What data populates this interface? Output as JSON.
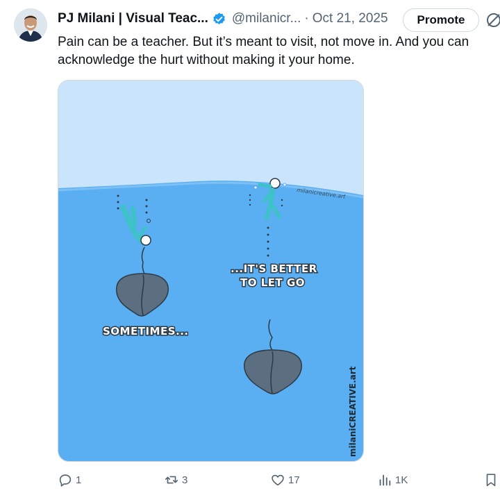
{
  "author": {
    "display_name": "PJ Milani | Visual Teac...",
    "handle": "@milanicr...",
    "separator": "·",
    "date": "Oct 21, 2025"
  },
  "header": {
    "promote_label": "Promote"
  },
  "tweet": {
    "text": "Pain can be a teacher. But it’s meant to visit, not move in. And you can acknowledge the hurt without making it your home."
  },
  "comic": {
    "caption_left": "SOMETIMES...",
    "caption_right_line1": "...IT'S BETTER",
    "caption_right_line2": "TO LET GO",
    "watermark_small": "milanicreative.art",
    "watermark_side": "milaniCREATIVE.art",
    "colors": {
      "sky": "#c9e4fb",
      "water": "#5aaef2",
      "rock": "#5b6f80",
      "figure": "#3fc1c9"
    }
  },
  "actions": {
    "replies": "1",
    "reposts": "3",
    "likes": "17",
    "views": "1K"
  },
  "icons": [
    "verified-badge-icon",
    "grok-icon",
    "reply-icon",
    "repost-icon",
    "like-icon",
    "views-icon",
    "bookmark-icon"
  ]
}
